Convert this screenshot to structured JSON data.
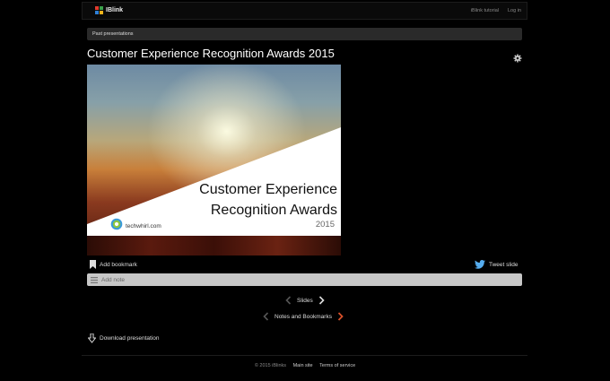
{
  "app": {
    "brand": "IBlink"
  },
  "nav": {
    "tutorial": "iBlink tutorial",
    "login": "Log in"
  },
  "breadcrumb": "Past presentations",
  "presentation": {
    "title": "Customer Experience Recognition Awards 2015",
    "slide": {
      "line1": "Customer Experience",
      "line2": "Recognition Awards",
      "year": "2015",
      "logo_text": "techwhirl.com"
    }
  },
  "actions": {
    "bookmark": "Add bookmark",
    "tweet": "Tweet slide",
    "note_placeholder": "Add note",
    "download": "Download presentation"
  },
  "pagers": {
    "slides": "Slides",
    "notes": "Notes and Bookmarks"
  },
  "footer": {
    "copyright": "© 2015 iBlinks",
    "main_site": "Main site",
    "terms": "Terms of service"
  },
  "colors": {
    "accent": "#d8502a",
    "twitter": "#55acee",
    "logo_red": "#e23b2e",
    "logo_green": "#3aa14a",
    "logo_blue": "#2f7fd6",
    "logo_yellow": "#f2b41b"
  }
}
